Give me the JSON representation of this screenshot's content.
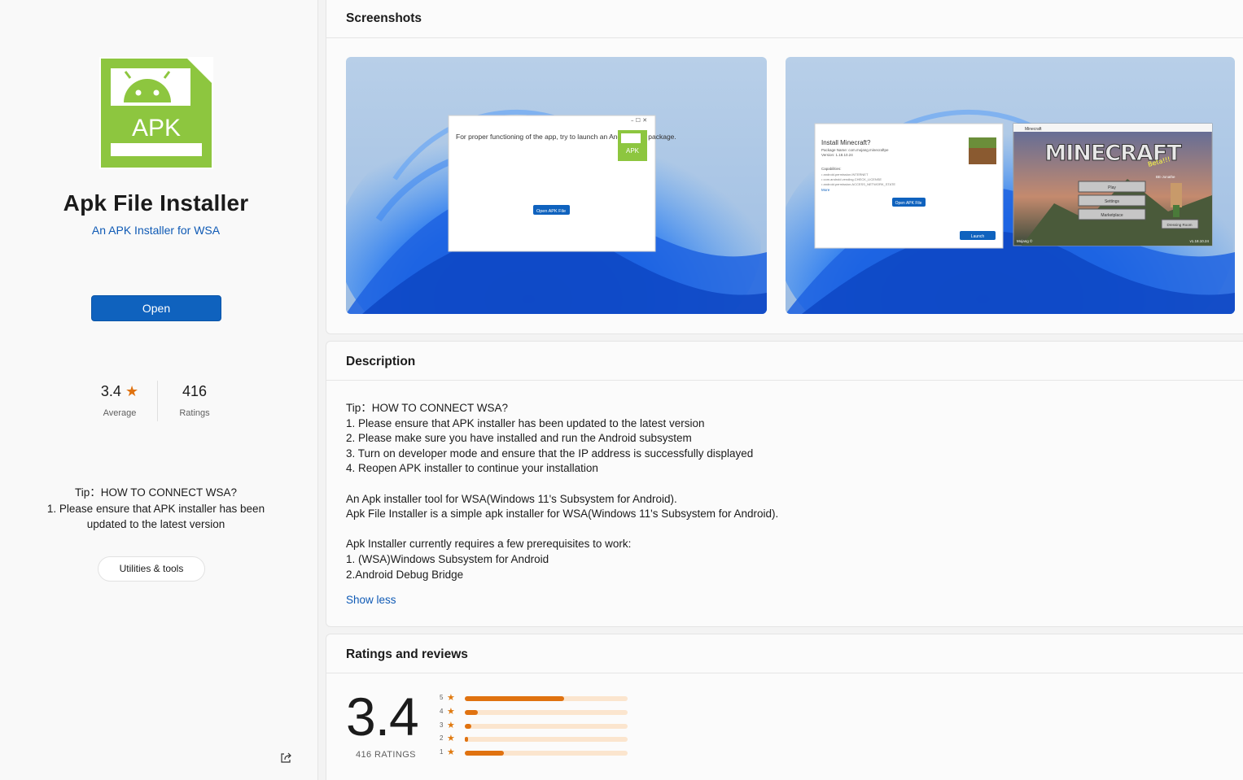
{
  "app": {
    "title": "Apk File Installer",
    "subtitle": "An APK Installer for WSA",
    "icon_text": "APK",
    "open_label": "Open",
    "rating_value": "3.4",
    "rating_label": "Average",
    "ratings_count": "416",
    "ratings_label": "Ratings",
    "tip_lines": [
      "Tip：HOW TO CONNECT WSA?",
      "1. Please ensure that APK installer has been updated to the latest version"
    ],
    "category_tag": "Utilities & tools",
    "icon_color": "#8dc63f"
  },
  "screenshots": {
    "heading": "Screenshots",
    "shot1": {
      "dialog_text": "For proper functioning of the app, try to launch an Android app package.",
      "button": "Open APK File",
      "icon_text": "APK"
    },
    "shot2": {
      "dialog_title": "Install Minecraft?",
      "package": "Package Name: com.mojang.minecraftpe",
      "version": "Version: 1.18.10.24",
      "capabilities": "Capabilities:",
      "cap_items": [
        "• android.permission.INTERNET",
        "• com.android.vending.CHECK_LICENSE",
        "• android.permission.ACCESS_NETWORK_STATE"
      ],
      "more": "More",
      "open_button": "Open APK File",
      "launch_button": "Launch",
      "game_window_title": "Minecraft",
      "game_logo": "MINECRAFT",
      "game_badge": "Beta!!!",
      "menu": [
        "Play",
        "Settings",
        "Marketplace"
      ],
      "dressing_room": "Dressing Room",
      "footer_left": "Mojang ©",
      "footer_right": "v1.18.10.24",
      "player": "BE-Jonathe"
    }
  },
  "description": {
    "heading": "Description",
    "para1": [
      "Tip：HOW TO CONNECT WSA?",
      "1. Please ensure that APK installer has been updated to the latest version",
      "2. Please make sure you have installed and run the Android subsystem",
      "3. Turn on developer mode and ensure that the IP address is successfully displayed",
      "4. Reopen APK installer to continue your installation"
    ],
    "para2": [
      "An Apk installer tool for WSA(Windows 11's Subsystem for Android).",
      "Apk File Installer is a simple apk installer for WSA(Windows 11's Subsystem for Android)."
    ],
    "para3": [
      "Apk Installer currently requires a few prerequisites to work:",
      "1. (WSA)Windows Subsystem for Android",
      "2.Android Debug Bridge"
    ],
    "show_less": "Show less"
  },
  "ratings": {
    "heading": "Ratings and reviews",
    "value": "3.4",
    "count_label": "416 RATINGS",
    "distribution": [
      {
        "stars": "5",
        "fraction": 0.61
      },
      {
        "stars": "4",
        "fraction": 0.08
      },
      {
        "stars": "3",
        "fraction": 0.04
      },
      {
        "stars": "2",
        "fraction": 0.02
      },
      {
        "stars": "1",
        "fraction": 0.24
      }
    ],
    "accent": "#e07210"
  }
}
